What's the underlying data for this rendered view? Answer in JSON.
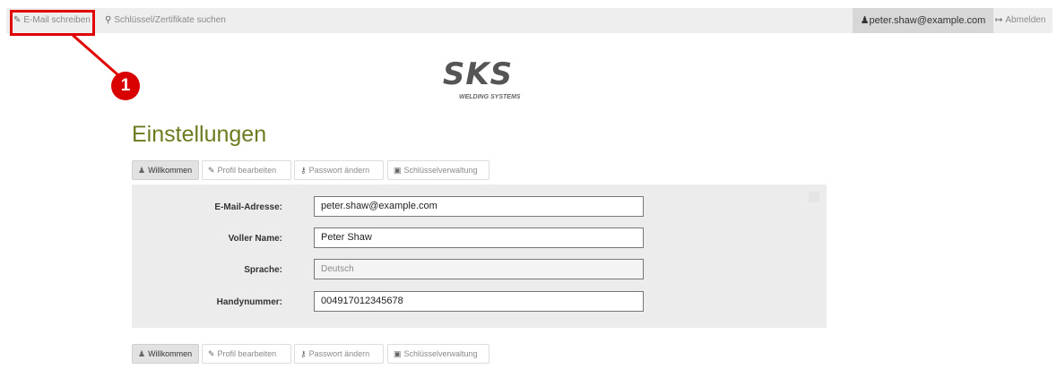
{
  "navbar": {
    "write_email": {
      "icon": "pencil-icon",
      "label": "E-Mail schreiben"
    },
    "search_keys": {
      "icon": "search-icon",
      "label": "Schlüssel/Zertifikate suchen"
    },
    "user": {
      "icon": "user-icon",
      "label": "peter.shaw@example.com"
    },
    "logout": {
      "icon": "logout-icon",
      "label": "Abmelden"
    }
  },
  "annotation": {
    "number": "1",
    "color": "#e00000"
  },
  "logo": {
    "text": "SKS",
    "subtitle": "WELDING SYSTEMS"
  },
  "page": {
    "title": "Einstellungen",
    "accent_color": "#6d7b1f"
  },
  "tabs": [
    {
      "icon": "user-icon",
      "label": "Willkommen",
      "active": true
    },
    {
      "icon": "pencil-icon",
      "label": "Profil bearbeiten",
      "active": false
    },
    {
      "icon": "key-icon",
      "label": "Passwort ändern",
      "active": false
    },
    {
      "icon": "lock-icon",
      "label": "Schlüsselverwaltung",
      "active": false
    }
  ],
  "form": {
    "email": {
      "label": "E-Mail-Adresse:",
      "value": "peter.shaw@example.com"
    },
    "name": {
      "label": "Voller Name:",
      "value": "Peter Shaw"
    },
    "language": {
      "label": "Sprache:",
      "value": "Deutsch"
    },
    "phone": {
      "label": "Handynummer:",
      "value": "004917012345678"
    }
  }
}
